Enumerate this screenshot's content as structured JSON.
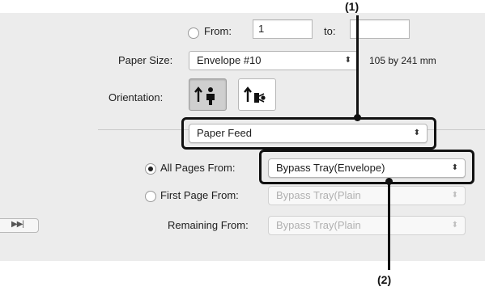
{
  "pages": {
    "from_label": "From:",
    "from_value": "1",
    "to_label": "to:"
  },
  "paper_size": {
    "label": "Paper Size:",
    "value": "Envelope #10",
    "dimensions": "105 by 241 mm"
  },
  "orientation": {
    "label": "Orientation:",
    "selected": "portrait"
  },
  "section_menu": {
    "value": "Paper Feed"
  },
  "paper_feed": {
    "all_pages": {
      "label": "All Pages From:",
      "value": "Bypass Tray(Envelope)",
      "selected": true
    },
    "first_page": {
      "label": "First Page From:",
      "value": "Bypass Tray(Plain",
      "selected": false
    },
    "remaining": {
      "label": "Remaining From:",
      "value": "Bypass Tray(Plain"
    }
  },
  "callouts": {
    "one": "(1)",
    "two": "(2)"
  },
  "icons": {
    "up_down": "⬍",
    "media": "▶▶|"
  }
}
